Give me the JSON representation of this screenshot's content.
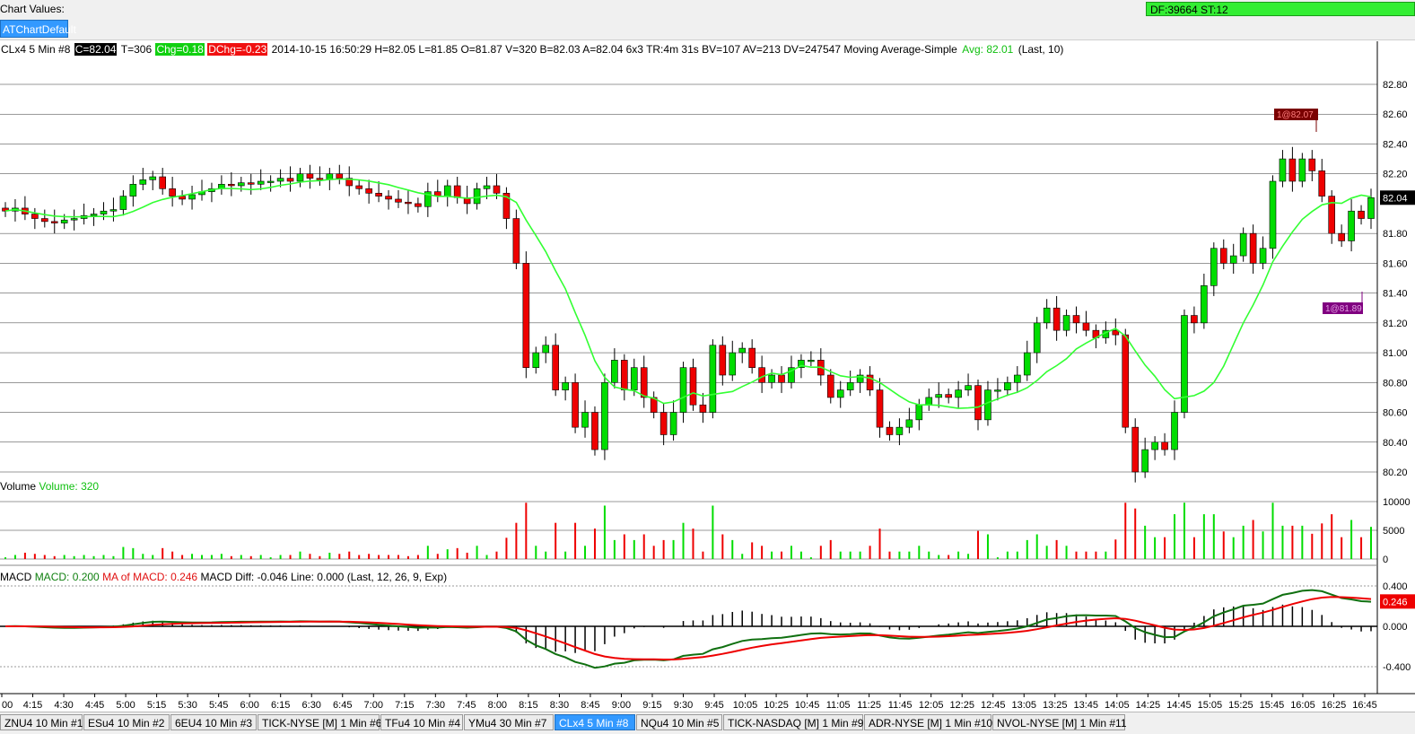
{
  "topbar": {
    "chart_values_label": "Chart Values:",
    "status": "DF:39664  ST:12"
  },
  "template_button": "ATChartDefault",
  "info": {
    "instrument": "CLx4  5 Min   #8",
    "close": "C=82.04",
    "ticks": "T=306",
    "change": "Chg=0.18",
    "dchange": "DChg=-0.23",
    "details": "2014-10-15 16:50:29 H=82.05 L=81.85 O=81.87 V=320 B=82.03 A=82.04 6x3 TR:4m 31s BV=107 AV=213 DV=247547 Moving Average-Simple",
    "avg": "Avg: 82.01",
    "params": "(Last, 10)"
  },
  "volume_panel": {
    "title": "Volume",
    "value": "Volume: 320"
  },
  "macd_panel": {
    "title": "MACD",
    "macd": "MACD: 0.200",
    "ma": "MA of MACD: 0.246",
    "diff": "MACD Diff: -0.046",
    "line": "Line: 0.000",
    "params": "(Last, 12, 26, 9, Exp)"
  },
  "price_axis": [
    "82.80",
    "82.60",
    "82.40",
    "82.20",
    "82.04",
    "81.80",
    "81.60",
    "81.40",
    "81.20",
    "81.00",
    "80.80",
    "80.60",
    "80.40",
    "80.20"
  ],
  "volume_axis": [
    "10000",
    "5000",
    "0"
  ],
  "macd_axis": [
    "0.400",
    "0.246",
    "0.000",
    "-0.400"
  ],
  "time_axis": [
    "00",
    "4:15",
    "4:30",
    "4:45",
    "5:00",
    "5:15",
    "5:30",
    "5:45",
    "6:00",
    "6:15",
    "6:30",
    "6:45",
    "7:00",
    "7:15",
    "7:30",
    "7:45",
    "8:00",
    "8:15",
    "8:30",
    "8:45",
    "9:00",
    "9:15",
    "9:30",
    "9:45",
    "10:05",
    "10:25",
    "10:45",
    "11:05",
    "11:25",
    "11:45",
    "12:05",
    "12:25",
    "12:45",
    "13:05",
    "13:25",
    "13:45",
    "14:05",
    "14:25",
    "14:45",
    "15:05",
    "15:25",
    "15:45",
    "16:05",
    "16:25",
    "16:45"
  ],
  "order_markers": {
    "sell": "1@82.07",
    "buy": "1@81.89"
  },
  "tabs": [
    {
      "label": "ZNU4  10 Min   #1",
      "active": false
    },
    {
      "label": "ESu4  10 Min   #2",
      "active": false
    },
    {
      "label": "6EU4  10 Min   #3",
      "active": false
    },
    {
      "label": "TICK-NYSE [M]  1 Min   #6",
      "active": false
    },
    {
      "label": "TFu4  10 Min   #4",
      "active": false
    },
    {
      "label": "YMu4  30 Min   #7",
      "active": false
    },
    {
      "label": "CLx4  5 Min   #8",
      "active": true
    },
    {
      "label": "NQu4  10 Min   #5",
      "active": false
    },
    {
      "label": "TICK-NASDAQ [M]  1 Min   #9",
      "active": false
    },
    {
      "label": "ADR-NYSE [M]  1 Min   #10",
      "active": false
    },
    {
      "label": "NVOL-NYSE [M]  1 Min   #11",
      "active": false
    }
  ],
  "colors": {
    "up": "#00dd00",
    "down": "#ee0000",
    "ma": "#33ff33",
    "macd": "#107010",
    "macd_ma": "#ee0000"
  },
  "chart_data": {
    "type": "candlestick",
    "instrument": "CLx4 5 Min",
    "ylim": [
      80.1,
      82.9
    ],
    "closes": [
      81.95,
      81.97,
      81.93,
      81.9,
      81.88,
      81.87,
      81.89,
      81.9,
      81.92,
      81.93,
      81.95,
      81.96,
      82.05,
      82.13,
      82.16,
      82.18,
      82.1,
      82.05,
      82.03,
      82.06,
      82.08,
      82.1,
      82.13,
      82.12,
      82.14,
      82.13,
      82.15,
      82.15,
      82.17,
      82.15,
      82.2,
      82.17,
      82.16,
      82.2,
      82.17,
      82.12,
      82.1,
      82.07,
      82.05,
      82.03,
      82.01,
      82.0,
      81.98,
      82.08,
      82.05,
      82.12,
      82.04,
      82.0,
      82.1,
      82.12,
      82.07,
      81.9,
      81.6,
      80.9,
      81.0,
      81.05,
      80.75,
      80.8,
      80.5,
      80.6,
      80.35,
      80.8,
      80.95,
      80.75,
      80.9,
      80.7,
      80.6,
      80.45,
      80.6,
      80.9,
      80.65,
      80.6,
      81.05,
      80.85,
      81.0,
      81.03,
      80.9,
      80.8,
      80.85,
      80.8,
      80.9,
      80.95,
      80.95,
      80.85,
      80.7,
      80.75,
      80.8,
      80.85,
      80.75,
      80.5,
      80.45,
      80.5,
      80.55,
      80.65,
      80.7,
      80.72,
      80.7,
      80.75,
      80.78,
      80.55,
      80.75,
      80.75,
      80.8,
      80.85,
      81.0,
      81.2,
      81.3,
      81.15,
      81.25,
      81.2,
      81.15,
      81.1,
      81.15,
      81.12,
      80.5,
      80.2,
      80.35,
      80.4,
      80.35,
      80.6,
      81.25,
      81.2,
      81.45,
      81.7,
      81.6,
      81.65,
      81.8,
      81.6,
      81.7,
      82.15,
      82.3,
      82.15,
      82.3,
      82.22,
      82.05,
      81.8,
      81.75,
      81.95,
      81.9,
      82.04
    ],
    "moving_average": {
      "type": "Simple",
      "period": 10,
      "last": 82.01
    },
    "volume_last": 320,
    "macd": {
      "last": 0.2,
      "ma_last": 0.246,
      "diff_last": -0.046,
      "params": [
        12,
        26,
        9
      ]
    }
  }
}
